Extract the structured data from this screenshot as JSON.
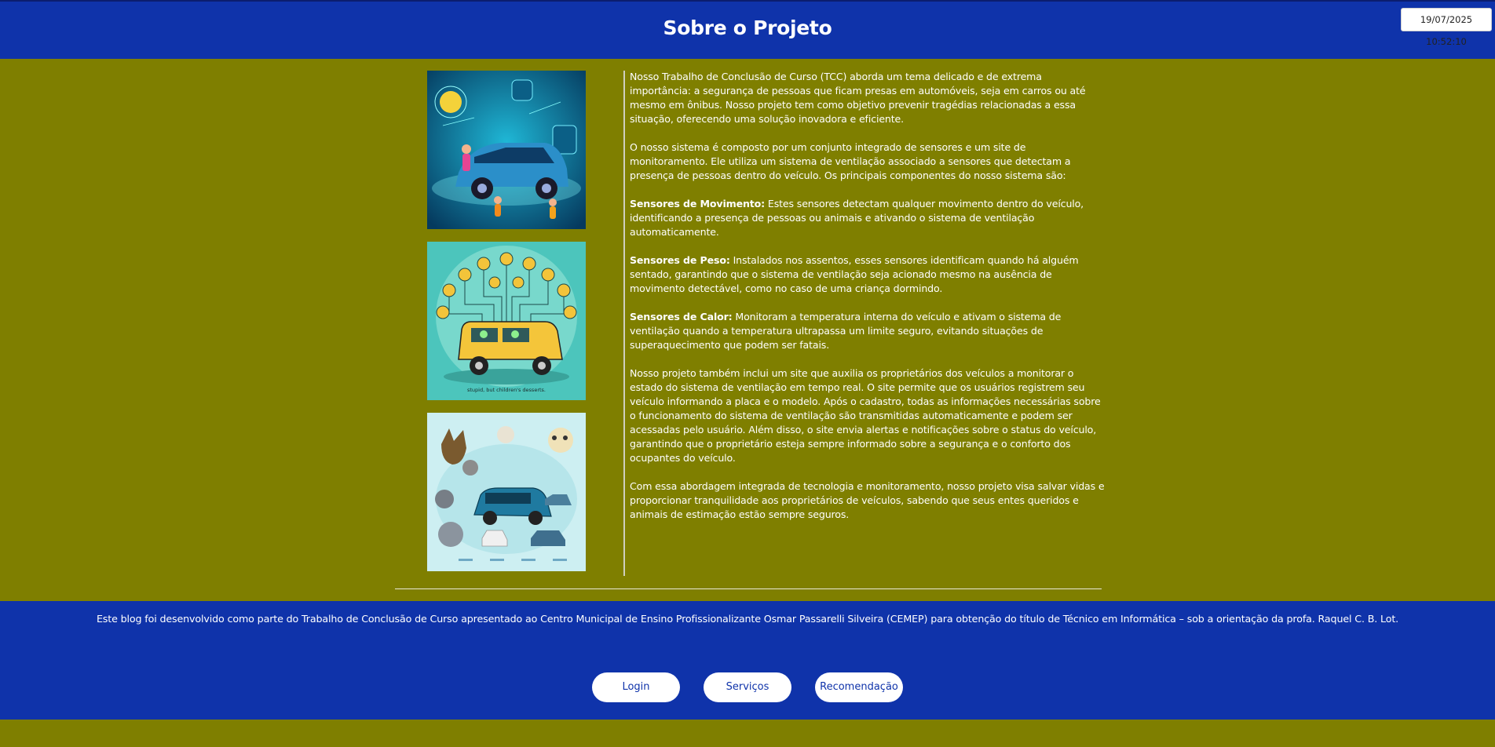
{
  "header": {
    "title": "Sobre o Projeto",
    "datetime": "19/07/2025 10:52:10"
  },
  "images": [
    {
      "caption": "stupid, but children's desserts."
    }
  ],
  "content": {
    "p1": "Nosso Trabalho de Conclusão de Curso (TCC) aborda um tema delicado e de extrema importância: a segurança de pessoas que ficam presas em automóveis, seja em carros ou até mesmo em ônibus. Nosso projeto tem como objetivo prevenir tragédias relacionadas a essa situação, oferecendo uma solução inovadora e eficiente.",
    "p2": "O nosso sistema é composto por um conjunto integrado de sensores e um site de monitoramento. Ele utiliza um sistema de ventilação associado a sensores que detectam a presença de pessoas dentro do veículo. Os principais componentes do nosso sistema são:",
    "items": [
      {
        "title": "Sensores de Movimento:",
        "text": " Estes sensores detectam qualquer movimento dentro do veículo, identificando a presença de pessoas ou animais e ativando o sistema de ventilação automaticamente."
      },
      {
        "title": "Sensores de Peso:",
        "text": " Instalados nos assentos, esses sensores identificam quando há alguém sentado, garantindo que o sistema de ventilação seja acionado mesmo na ausência de movimento detectável, como no caso de uma criança dormindo."
      },
      {
        "title": "Sensores de Calor:",
        "text": " Monitoram a temperatura interna do veículo e ativam o sistema de ventilação quando a temperatura ultrapassa um limite seguro, evitando situações de superaquecimento que podem ser fatais."
      }
    ],
    "p3": "Nosso projeto também inclui um site que auxilia os proprietários dos veículos a monitorar o estado do sistema de ventilação em tempo real. O site permite que os usuários registrem seu veículo informando a placa e o modelo. Após o cadastro, todas as informações necessárias sobre o funcionamento do sistema de ventilação são transmitidas automaticamente e podem ser acessadas pelo usuário. Além disso, o site envia alertas e notificações sobre o status do veículo, garantindo que o proprietário esteja sempre informado sobre a segurança e o conforto dos ocupantes do veículo.",
    "p4": "Com essa abordagem integrada de tecnologia e monitoramento, nosso projeto visa salvar vidas e proporcionar tranquilidade aos proprietários de veículos, sabendo que seus entes queridos e animais de estimação estão sempre seguros."
  },
  "footer": {
    "text": "Este blog foi desenvolvido como parte do Trabalho de Conclusão de Curso apresentado ao Centro Municipal de Ensino Profissionalizante Osmar Passarelli Silveira (CEMEP) para obtenção do título de Técnico em Informática – sob a orientação da profa. Raquel C. B. Lot.",
    "nav": [
      "Login",
      "Serviços",
      "Recomendação"
    ]
  },
  "colors": {
    "header_bg": "#0f33aa",
    "page_bg": "#7f7f00",
    "button_text": "#0f33aa"
  }
}
